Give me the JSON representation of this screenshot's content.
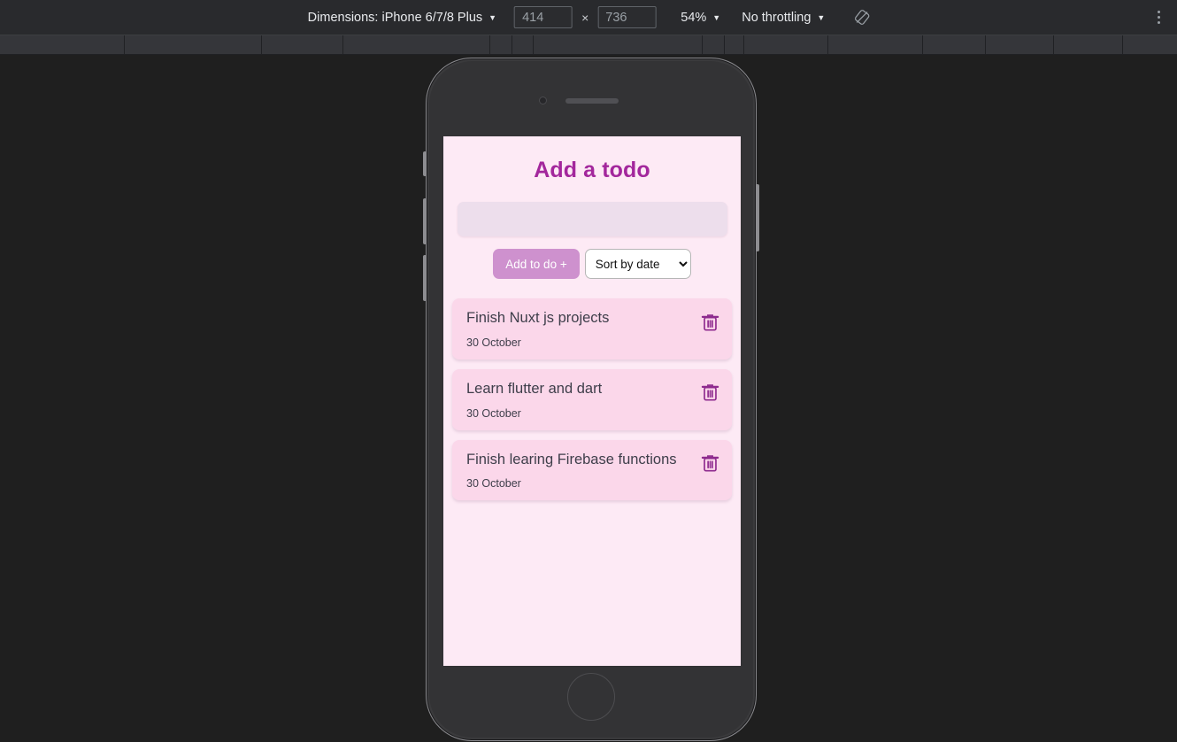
{
  "devtools_toolbar": {
    "dimensions_label": "Dimensions: iPhone 6/7/8 Plus",
    "width_value": "414",
    "height_value": "736",
    "multiply_symbol": "×",
    "zoom_label": "54%",
    "throttling_label": "No throttling",
    "caret_glyph": "▼",
    "rotate_icon_name": "rotate-device-icon",
    "menu_icon_name": "more-options-icon"
  },
  "ruler": {
    "tick_positions": [
      140,
      295,
      387,
      553,
      578,
      602,
      793,
      818,
      840,
      935,
      1042,
      1113,
      1190,
      1268
    ]
  },
  "app": {
    "title": "Add a todo",
    "input_placeholder": "",
    "input_value": "",
    "add_button_label": "Add to do +",
    "sort_selected": "Sort by date",
    "sort_options": [
      "Sort by date"
    ],
    "todos": [
      {
        "text": "Finish Nuxt js projects",
        "date": "30 October"
      },
      {
        "text": "Learn flutter and dart",
        "date": "30 October"
      },
      {
        "text": "Finish learing Firebase functions",
        "date": "30 October"
      }
    ],
    "colors": {
      "background": "#fdeaf5",
      "title": "#a3279c",
      "card": "#fbd7ea",
      "accent_button": "#ce91ce",
      "trash": "#8e2a8e"
    }
  }
}
